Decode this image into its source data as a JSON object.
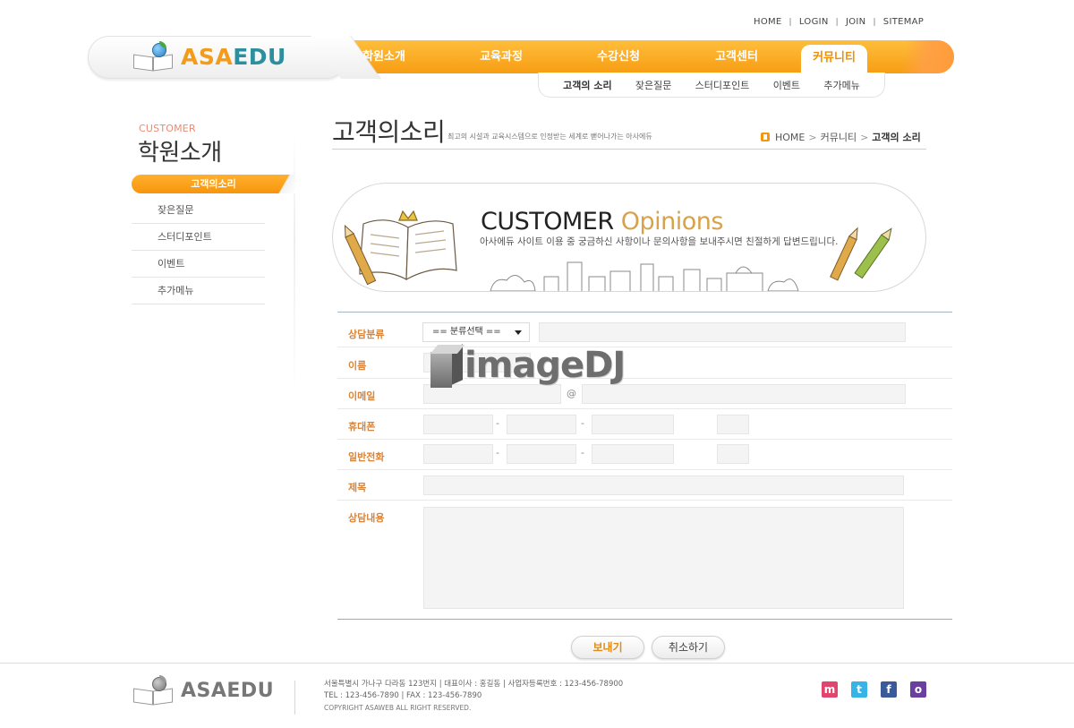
{
  "top_links": [
    "HOME",
    "LOGIN",
    "JOIN",
    "SITEMAP"
  ],
  "brand": {
    "part1": "ASA",
    "part2": "EDU",
    "colors": {
      "accent": "#f39c1b",
      "teal": "#2b8f9e"
    }
  },
  "main_nav": [
    {
      "label": "학원소개",
      "active": false
    },
    {
      "label": "교육과정",
      "active": false
    },
    {
      "label": "수강신청",
      "active": false
    },
    {
      "label": "고객센터",
      "active": false
    },
    {
      "label": "커뮤니티",
      "active": true
    }
  ],
  "sub_nav": [
    "고객의 소리",
    "잦은질문",
    "스터디포인트",
    "이벤트",
    "추가메뉴"
  ],
  "sidebar": {
    "small_title": "CUSTOMER",
    "title": "학원소개",
    "active_item": "고객의소리",
    "items": [
      "잦은질문",
      "스터디포인트",
      "이벤트",
      "추가메뉴"
    ]
  },
  "page": {
    "title": "고객의소리",
    "subtitle": "최고의 시설과 교육시스템으로 인정받는 세계로 뻗어나가는 아사에듀",
    "breadcrumb": [
      "HOME",
      "커뮤니티",
      "고객의 소리"
    ]
  },
  "banner": {
    "title_main": "CUSTOMER ",
    "title_accent": "Opinions",
    "description": "아사에듀 사이트 이용 중 궁금하신 사항이나 문의사항을 보내주시면 친절하게 답변드립니다."
  },
  "form": {
    "category_label": "상담분류",
    "category_select": "== 분류선택 ==",
    "name_label": "이름",
    "email_label": "이메일",
    "email_at": "@",
    "mobile_label": "휴대폰",
    "phone_label": "일반전화",
    "dash": "-",
    "subject_label": "제목",
    "content_label": "상담내용"
  },
  "buttons": {
    "send": "보내기",
    "cancel": "취소하기"
  },
  "watermark": "imageDJ",
  "footer": {
    "brand": "ASAEDU",
    "address": "서울특별시 가나구 다라동 123번지  |  대표이사 : 홍길동  |  사업자등록번호 : 123-456-78900",
    "tel": "TEL : 123-456-7890  |  FAX : 123-456-7890",
    "copyright": "COPYRIGHT ASAWEB ALL RIGHT RESERVED.",
    "social": [
      {
        "name": "me2day-icon",
        "glyph": "m",
        "color": "#e0456d"
      },
      {
        "name": "twitter-icon",
        "glyph": "t",
        "color": "#36b4e6"
      },
      {
        "name": "facebook-icon",
        "glyph": "f",
        "color": "#3a5a99"
      },
      {
        "name": "chat-icon",
        "glyph": "o",
        "color": "#6b3fa0"
      }
    ]
  }
}
